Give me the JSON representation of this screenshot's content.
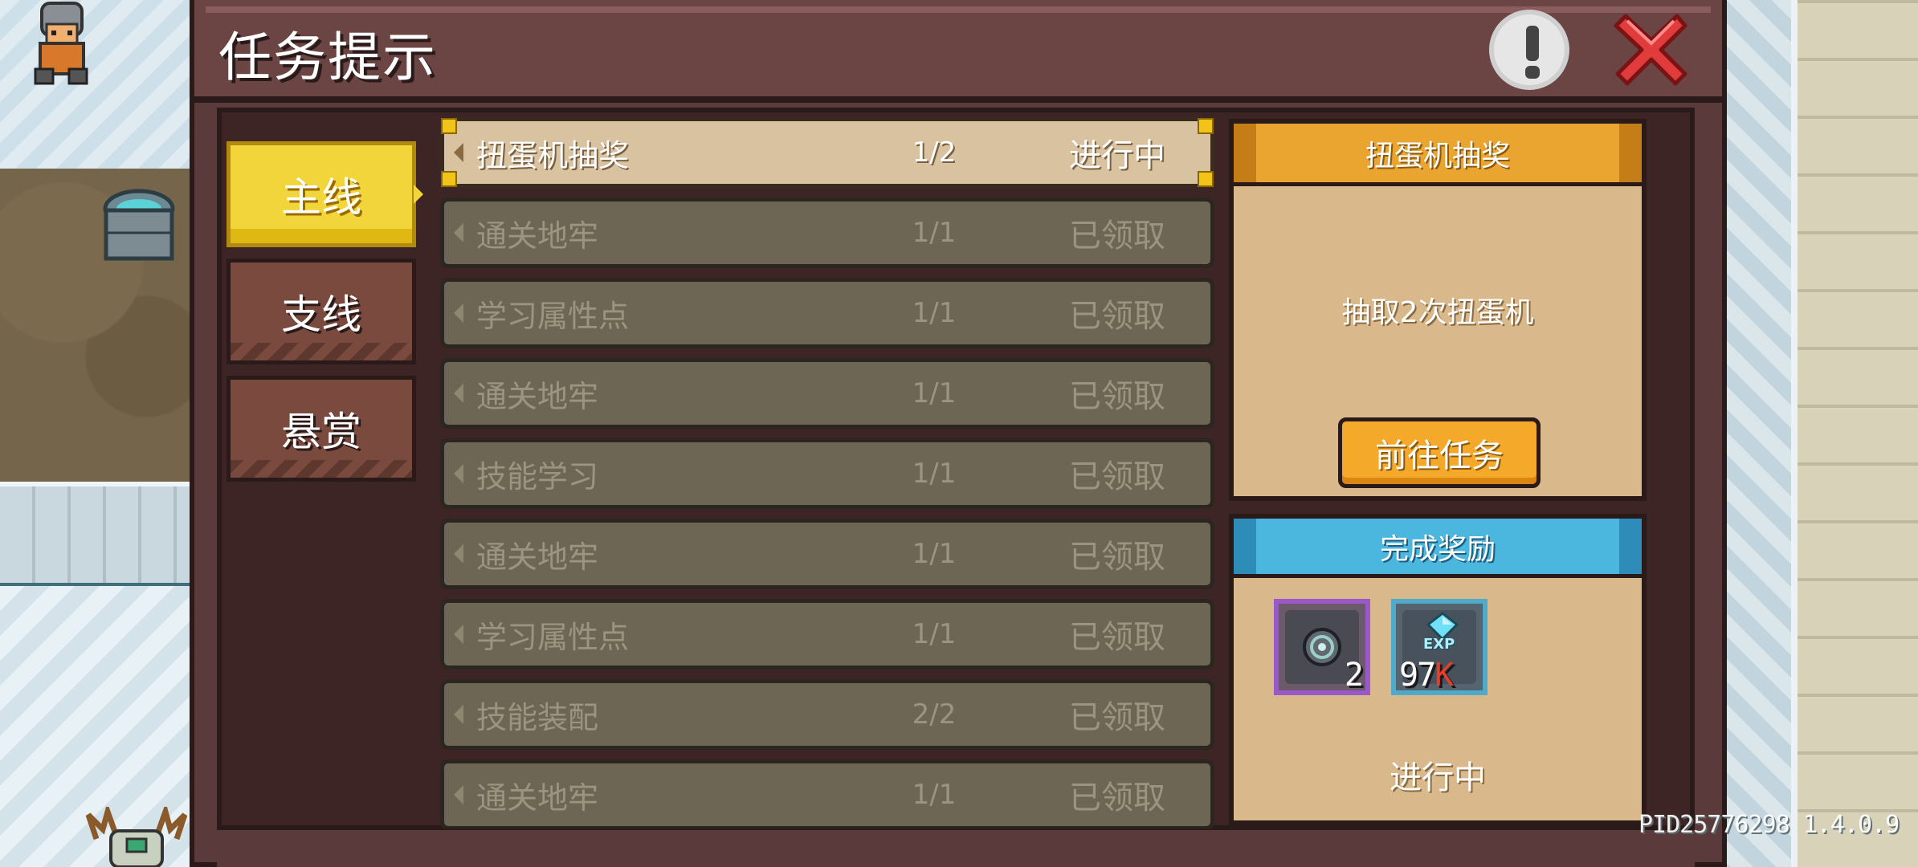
{
  "header": {
    "title": "任务提示"
  },
  "tabs": [
    {
      "label": "主线",
      "active": true
    },
    {
      "label": "支线",
      "active": false
    },
    {
      "label": "悬赏",
      "active": false
    }
  ],
  "quests": [
    {
      "name": "扭蛋机抽奖",
      "progress": "1/2",
      "status": "进行中",
      "active": true
    },
    {
      "name": "通关地牢",
      "progress": "1/1",
      "status": "已领取",
      "active": false
    },
    {
      "name": "学习属性点",
      "progress": "1/1",
      "status": "已领取",
      "active": false
    },
    {
      "name": "通关地牢",
      "progress": "1/1",
      "status": "已领取",
      "active": false
    },
    {
      "name": "技能学习",
      "progress": "1/1",
      "status": "已领取",
      "active": false
    },
    {
      "name": "通关地牢",
      "progress": "1/1",
      "status": "已领取",
      "active": false
    },
    {
      "name": "学习属性点",
      "progress": "1/1",
      "status": "已领取",
      "active": false
    },
    {
      "name": "技能装配",
      "progress": "2/2",
      "status": "已领取",
      "active": false
    },
    {
      "name": "通关地牢",
      "progress": "1/1",
      "status": "已领取",
      "active": false
    }
  ],
  "detail": {
    "title": "扭蛋机抽奖",
    "description": "抽取2次扭蛋机",
    "goto_label": "前往任务"
  },
  "reward": {
    "title": "完成奖励",
    "items": [
      {
        "icon": "gacha-coin-icon",
        "count": "2"
      },
      {
        "icon": "exp-crystal-icon",
        "tag": "EXP",
        "amount": "97",
        "unit": "K"
      }
    ],
    "status": "进行中"
  },
  "version_text": "PID25776298 1.4.0.9",
  "colors": {
    "active_tab": "#f2d53a",
    "active_row": "#d8c29f",
    "detail_header": "#eaa530",
    "reward_header": "#4bb6de",
    "goto_button": "#f5a92a",
    "close_red": "#e23b3b"
  }
}
